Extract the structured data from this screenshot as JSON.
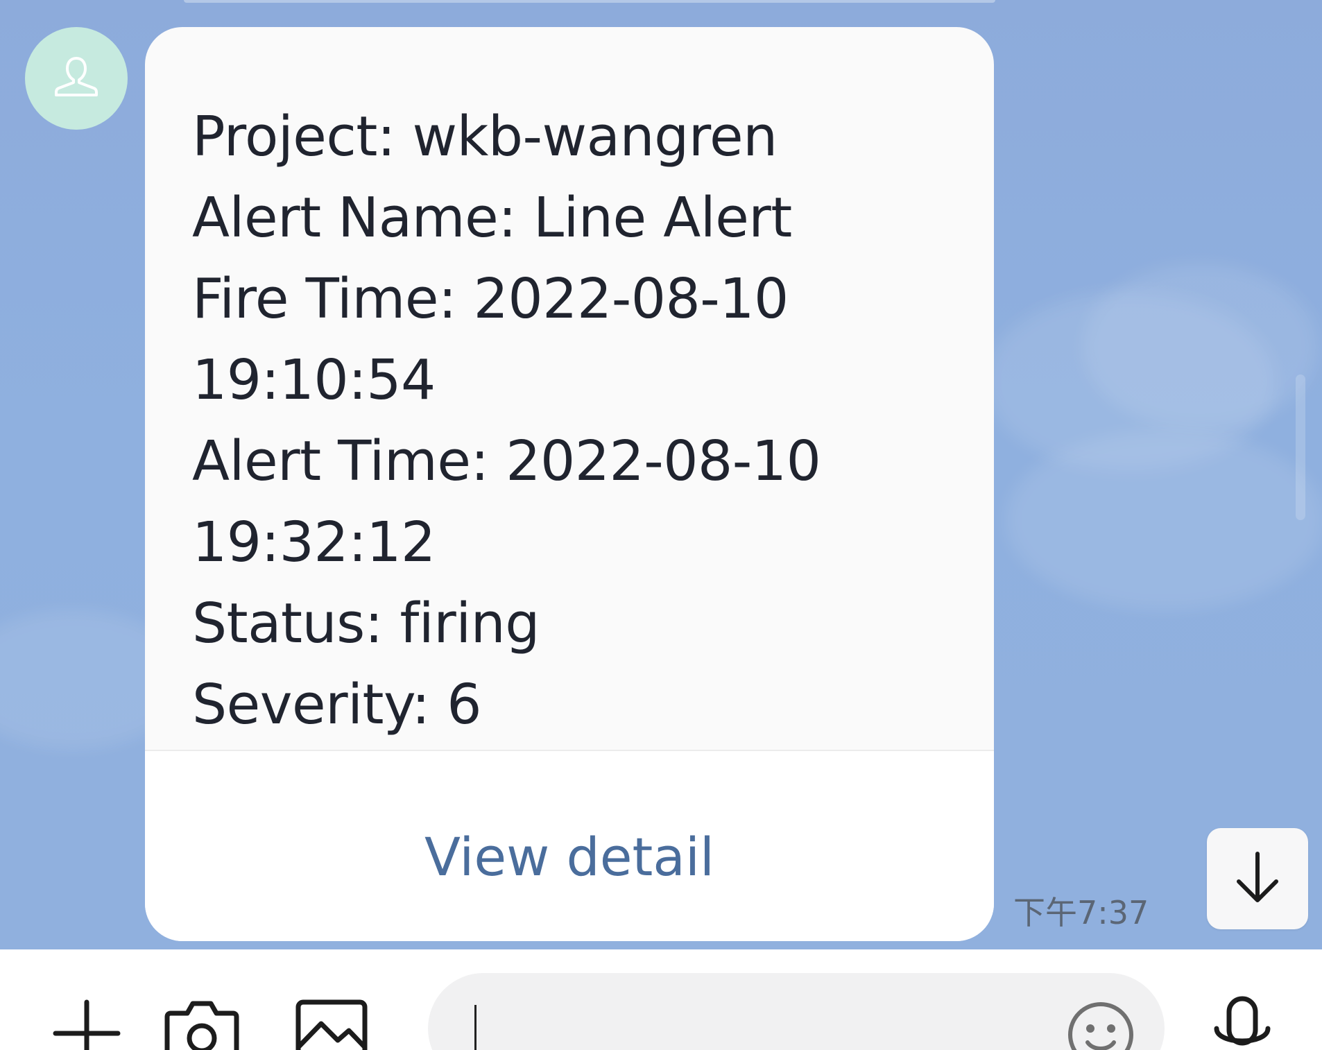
{
  "message": {
    "lines": [
      "Project: wkb-wangren",
      "Alert Name: Line Alert",
      "Fire Time: 2022-08-10",
      "19:10:54",
      "Alert Time: 2022-08-10",
      "19:32:12",
      "Status: firing",
      "Severity: 6"
    ],
    "action_label": "View detail",
    "timestamp": "下午7:37"
  },
  "composer": {
    "input_value": "",
    "icons": [
      "plus-icon",
      "camera-icon",
      "image-icon",
      "smiley-icon",
      "microphone-icon"
    ]
  },
  "icons": {
    "avatar": "person-icon",
    "scroll": "arrow-down-icon"
  },
  "colors": {
    "chat_background": "#8dabdb",
    "bubble": "#fafafa",
    "avatar": "#c6eadf",
    "link": "#4a6d9c",
    "text": "#20242f"
  }
}
